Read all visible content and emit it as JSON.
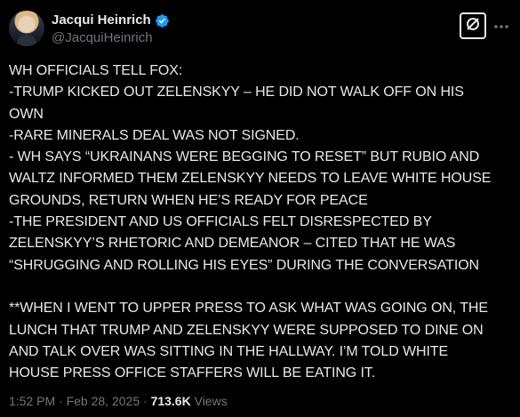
{
  "author": {
    "display_name": "Jacqui Heinrich",
    "handle": "@JacquiHeinrich",
    "verified": true,
    "verified_color": "#1d9bf0"
  },
  "actions": {
    "grok_icon": "grok-slash-icon",
    "more_icon": "more-dots-icon"
  },
  "tweet": {
    "lines": [
      "WH OFFICIALS TELL FOX:",
      "-TRUMP KICKED OUT ZELENSKYY – HE DID NOT WALK OFF ON HIS",
      "OWN",
      "-RARE MINERALS DEAL WAS NOT SIGNED.",
      "- WH SAYS “UKRAINANS WERE BEGGING TO RESET” BUT RUBIO AND",
      "WALTZ INFORMED THEM ZELENSKYY NEEDS TO LEAVE WHITE HOUSE",
      "GROUNDS, RETURN WHEN HE’S READY FOR PEACE",
      "-THE PRESIDENT AND US OFFICIALS FELT DISRESPECTED BY",
      "ZELENSKYY’S RHETORIC AND DEMEANOR – CITED THAT HE WAS",
      "“SHRUGGING AND ROLLING HIS EYES” DURING THE CONVERSATION",
      "",
      "**WHEN I WENT TO UPPER PRESS TO ASK WHAT WAS GOING ON, THE",
      "LUNCH THAT TRUMP AND ZELENSKYY WERE SUPPOSED TO DINE ON",
      "AND TALK OVER WAS SITTING IN THE HALLWAY. I’M TOLD WHITE",
      "HOUSE PRESS OFFICE STAFFERS WILL BE EATING IT."
    ]
  },
  "meta": {
    "time": "1:52 PM",
    "separator": "·",
    "date": "Feb 28, 2025",
    "views_count": "713.6K",
    "views_label": "Views"
  },
  "colors": {
    "background": "#000000",
    "text_primary": "#e7e9ea",
    "text_secondary": "#71767b"
  }
}
